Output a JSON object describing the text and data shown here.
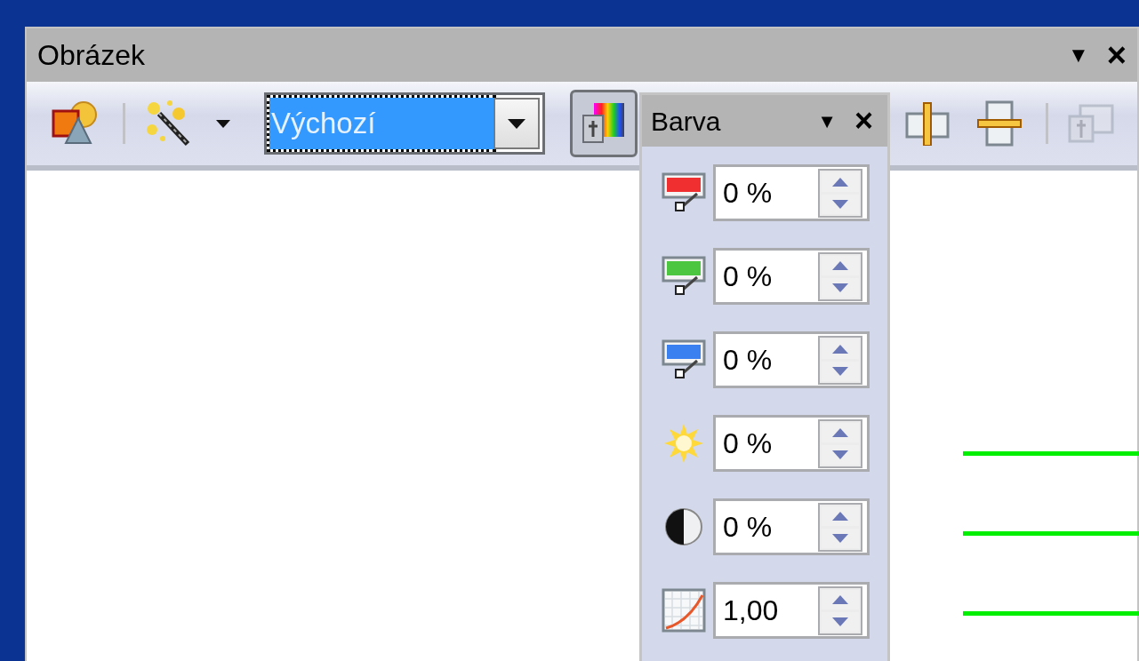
{
  "window": {
    "title": "Obrázek",
    "menu_glyph": "▼",
    "close_glyph": "×"
  },
  "toolbar": {
    "mode_combo": {
      "value": "Výchozí",
      "focused": true
    },
    "color_button": {
      "pressed": true
    },
    "transparency_button": {
      "disabled": true
    }
  },
  "color_panel": {
    "title": "Barva",
    "menu_glyph": "▼",
    "close_glyph": "×",
    "rows": [
      {
        "kind": "red",
        "value": "0 %"
      },
      {
        "kind": "green",
        "value": "0 %"
      },
      {
        "kind": "blue",
        "value": "0 %"
      },
      {
        "kind": "brightness",
        "value": "0 %"
      },
      {
        "kind": "contrast",
        "value": "0 %"
      },
      {
        "kind": "gamma",
        "value": "1,00"
      }
    ]
  }
}
